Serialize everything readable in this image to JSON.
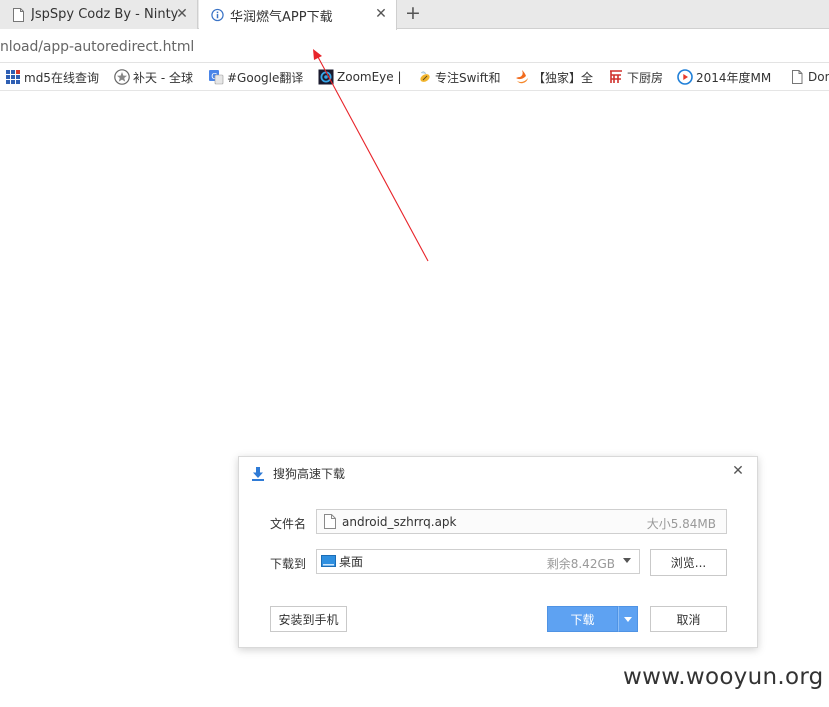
{
  "tabs": [
    {
      "title": "JspSpy Codz By - Ninty",
      "icon": "page-icon",
      "active": false
    },
    {
      "title": "华润燃气APP下载",
      "icon": "site-info-icon",
      "active": true
    }
  ],
  "address_bar": {
    "url": "nload/app-autoredirect.html"
  },
  "bookmarks": [
    {
      "label": "md5在线查询",
      "icon": "grid-icon"
    },
    {
      "label": "补天 - 全球",
      "icon": "star-badge-icon"
    },
    {
      "label": "#Google翻译",
      "icon": "google-translate-icon"
    },
    {
      "label": "ZoomEye |",
      "icon": "zoomeye-eye-icon"
    },
    {
      "label": "专注Swift和",
      "icon": "bee-icon"
    },
    {
      "label": "【独家】全",
      "icon": "swift-bird-icon"
    },
    {
      "label": "下厨房",
      "icon": "kitchen-icon"
    },
    {
      "label": "2014年度MM",
      "icon": "play-circle-icon"
    },
    {
      "label": "Don",
      "icon": "page-icon"
    }
  ],
  "dialog": {
    "title": "搜狗高速下载",
    "file_label": "文件名",
    "file_name": "android_szhrrq.apk",
    "file_size": "大小5.84MB",
    "dest_label": "下载到",
    "dest_folder": "桌面",
    "free_space": "剩余8.42GB",
    "browse_button": "浏览...",
    "install_button": "安装到手机",
    "download_button": "下载",
    "cancel_button": "取消"
  },
  "watermark": "www.wooyun.org",
  "colors": {
    "accent_blue": "#5ea2f2",
    "annotation_red": "#e8242a"
  }
}
